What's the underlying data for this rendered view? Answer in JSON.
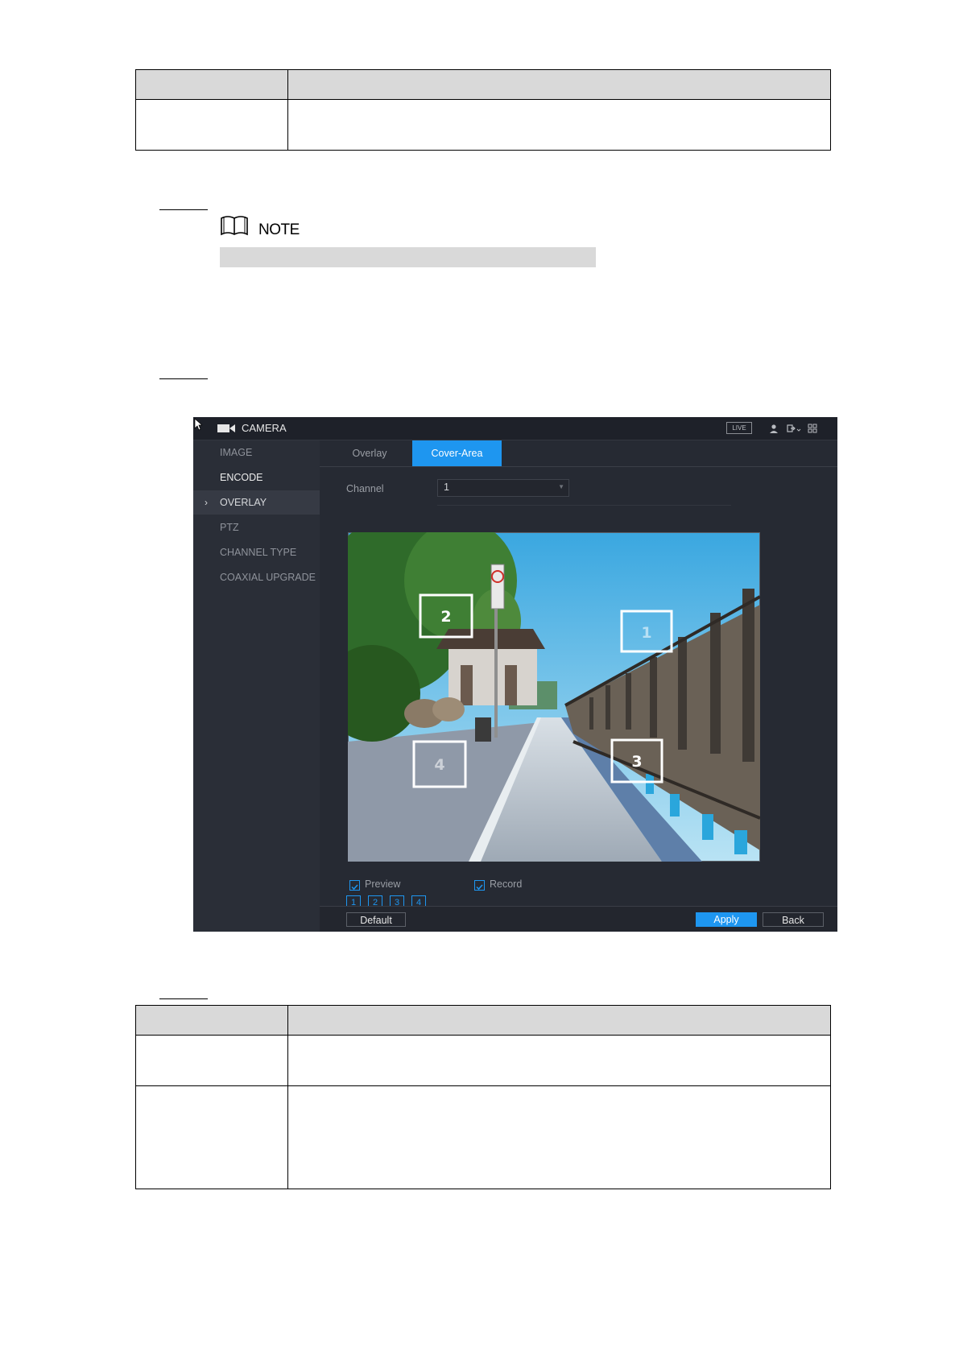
{
  "note": {
    "title": "NOTE"
  },
  "ui": {
    "app_title": "CAMERA",
    "live_badge": "LIVE",
    "sidebar": {
      "items": [
        {
          "label": "IMAGE"
        },
        {
          "label": "ENCODE"
        },
        {
          "label": "OVERLAY",
          "active": true
        },
        {
          "label": "PTZ"
        },
        {
          "label": "CHANNEL TYPE"
        },
        {
          "label": "COAXIAL UPGRADE"
        }
      ],
      "active_marker": "›"
    },
    "tabs": [
      {
        "label": "Overlay"
      },
      {
        "label": "Cover-Area",
        "active": true
      }
    ],
    "channel": {
      "label": "Channel",
      "value": "1"
    },
    "cover_areas": [
      "2",
      "1",
      "4",
      "3"
    ],
    "checkboxes": {
      "preview": {
        "label": "Preview",
        "checked": true
      },
      "record": {
        "label": "Record",
        "checked": true
      }
    },
    "area_buttons": [
      "1",
      "2",
      "3",
      "4"
    ],
    "buttons": {
      "default": "Default",
      "apply": "Apply",
      "back": "Back"
    },
    "accent_color": "#1e96f0"
  }
}
